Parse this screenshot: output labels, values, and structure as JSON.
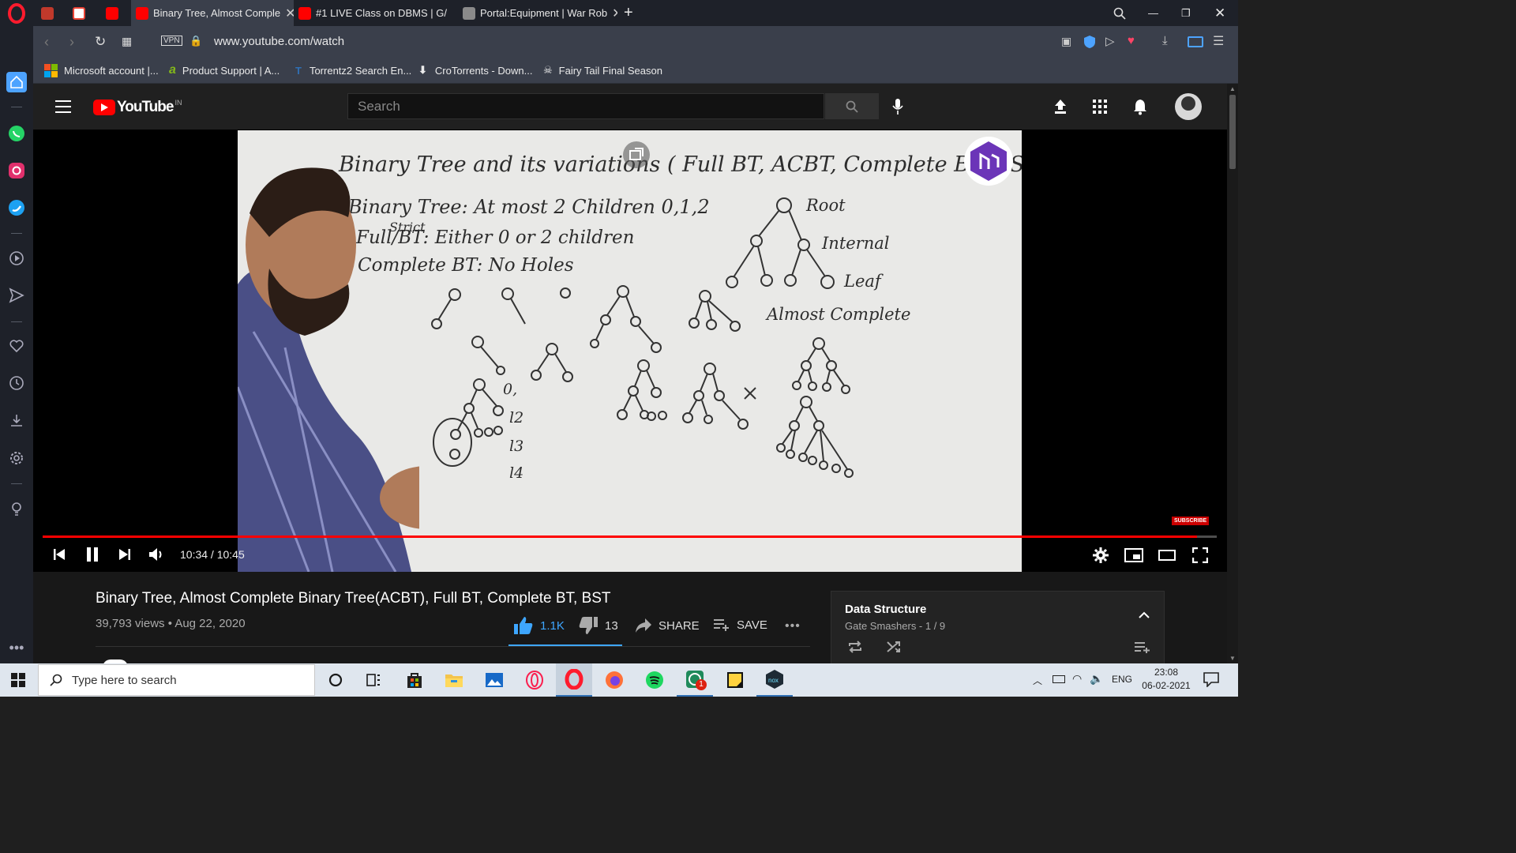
{
  "browser": {
    "tabs": [
      {
        "label": "",
        "color": "#c0392b"
      },
      {
        "label": "",
        "color": "#ea4335"
      },
      {
        "label": "",
        "color": "#ff0000"
      },
      {
        "label": "Binary Tree, Almost Comple",
        "color": "#ff0000",
        "active": true
      },
      {
        "label": "#1 LIVE Class on DBMS | G/",
        "color": "#ff0000"
      },
      {
        "label": "Portal:Equipment | War Rob",
        "color": "#8a8a8a"
      }
    ],
    "url": "www.youtube.com/watch",
    "vpn_label": "VPN",
    "bookmarks": [
      {
        "label": "Microsoft account |...",
        "icon": "microsoft-icon"
      },
      {
        "label": "Product Support | A...",
        "icon": "acer-icon"
      },
      {
        "label": "Torrentz2 Search En...",
        "icon": "torrentz-icon"
      },
      {
        "label": "CroTorrents - Down...",
        "icon": "download-arrow-icon"
      },
      {
        "label": "Fairy Tail Final Season",
        "icon": "skull-icon"
      }
    ]
  },
  "youtube": {
    "logo_text": "YouTube",
    "country": "IN",
    "search_placeholder": "Search",
    "video": {
      "time": "10:34 / 10:45",
      "progress": 0.983,
      "subscribe_badge": "SUBSCRIBE",
      "whiteboard": {
        "title": "Binary Tree and its variations ( Full BT, ACBT, Complete BT, BST)",
        "line1": "Binary Tree: At most 2 Children 0,1,2",
        "line2_note": "Strict",
        "line2": "Full/BT: Either 0 or 2 children",
        "line3": "Complete BT: No Holes",
        "labels": [
          "Root",
          "Internal",
          "Leaf",
          "Almost Complete"
        ],
        "levels": [
          "0,",
          "l2",
          "l3",
          "l4"
        ]
      }
    },
    "title": "Binary Tree, Almost Complete Binary Tree(ACBT), Full BT, Complete BT, BST",
    "meta": "39,793 views • Aug 22, 2020",
    "likes": "1.1K",
    "dislikes": "13",
    "share_label": "SHARE",
    "save_label": "SAVE",
    "playlist": {
      "title": "Data Structure",
      "subtitle": "Gate Smashers - 1 / 9"
    }
  },
  "taskbar": {
    "search_placeholder": "Type here to search",
    "language": "ENG",
    "time": "23:08",
    "date": "06-02-2021",
    "badge": "1"
  },
  "colors": {
    "youtube_red": "#ff0000",
    "like_blue": "#3ea6ff",
    "opera_red": "#ff1b2d"
  }
}
